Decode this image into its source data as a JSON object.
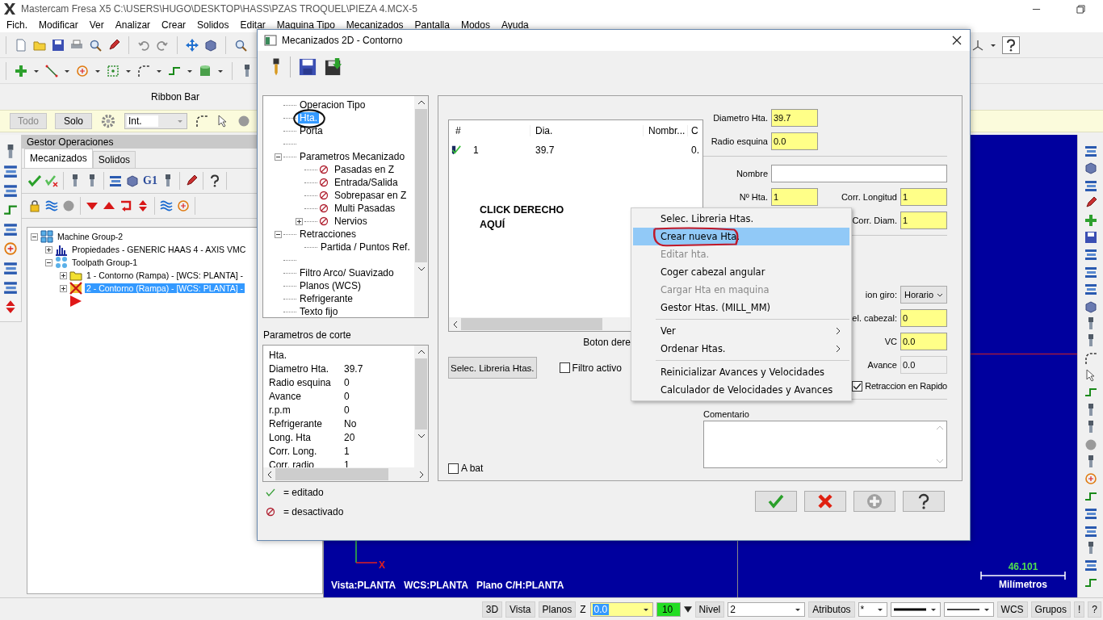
{
  "app": {
    "title": "Mastercam Fresa X5  C:\\USERS\\HUGO\\DESKTOP\\HASS\\PZAS TROQUEL\\PIEZA 4.MCX-5"
  },
  "menu": [
    "Fich.",
    "Modificar",
    "Ver",
    "Analizar",
    "Crear",
    "Solidos",
    "Editar",
    "Maquina Tipo",
    "Mecanizados",
    "Pantalla",
    "Modos",
    "Ayuda"
  ],
  "ribbon_bar": "Ribbon Bar",
  "selection_bar": {
    "buttons": [
      {
        "label": "Todo",
        "disabled": true
      },
      {
        "label": "Solo",
        "disabled": false
      }
    ],
    "mode": "Int."
  },
  "op_manager": {
    "title": "Gestor Operaciones",
    "tabs": [
      {
        "label": "Mecanizados",
        "selected": true
      },
      {
        "label": "Solidos",
        "selected": false
      }
    ],
    "g_code_label": "G1",
    "tree": [
      {
        "kind": "machine",
        "label": "Machine Group-2",
        "selected": false,
        "expanded": true,
        "children": [
          {
            "kind": "properties",
            "label": "Propiedades - GENERIC HAAS 4 - AXIS VMC",
            "selected": false,
            "expanded": false
          },
          {
            "kind": "group",
            "label": "Toolpath Group-1",
            "selected": false,
            "expanded": true,
            "children": [
              {
                "kind": "operation",
                "label": "1 - Contorno  (Rampa) - [WCS: PLANTA] -",
                "selected": false,
                "dirty": false,
                "expanded": false
              },
              {
                "kind": "operation",
                "label": "2 - Contorno  (Rampa) - [WCS: PLANTA] -",
                "selected": true,
                "dirty": true,
                "expanded": false
              },
              {
                "kind": "insert-marker",
                "selected": false
              }
            ]
          }
        ]
      }
    ]
  },
  "viewport": {
    "info": [
      "Vista:PLANTA",
      "WCS:PLANTA",
      "Plano C/H:PLANTA"
    ],
    "x_axis": "X",
    "scale": {
      "value": "46.101",
      "unit": "Milímetros"
    }
  },
  "status_bar": {
    "buttons_left": [
      "3D",
      "Vista",
      "Planos"
    ],
    "z_label": "Z",
    "z_value": "0.0",
    "color_value": "10",
    "level_label": "Nivel",
    "level_value": "2",
    "attributes": "Atributos",
    "point_style": "*",
    "buttons_right": [
      "WCS",
      "Grupos",
      "!",
      "?"
    ]
  },
  "dialog": {
    "title": "Mecanizados 2D - Contorno",
    "tree": [
      {
        "kind": "node",
        "label": "Operacion Tipo",
        "selected": false,
        "circled": false,
        "disabled": false
      },
      {
        "kind": "node",
        "label": "Hta.",
        "selected": true,
        "circled": true,
        "disabled": false
      },
      {
        "kind": "node",
        "label": "Porta",
        "selected": false,
        "circled": false,
        "disabled": false
      },
      {
        "kind": "blank"
      },
      {
        "kind": "node",
        "label": "Parametros Mecanizado",
        "selected": false,
        "circled": false,
        "disabled": false,
        "expanded": true,
        "children": [
          {
            "kind": "node",
            "label": "Pasadas en Z",
            "selected": false,
            "circled": false,
            "disabled": true
          },
          {
            "kind": "node",
            "label": "Entrada/Salida",
            "selected": false,
            "circled": false,
            "disabled": true
          },
          {
            "kind": "node",
            "label": "Sobrepasar en Z",
            "selected": false,
            "circled": false,
            "disabled": true
          },
          {
            "kind": "node",
            "label": "Multi Pasadas",
            "selected": false,
            "circled": false,
            "disabled": true
          },
          {
            "kind": "node",
            "label": "Nervios",
            "selected": false,
            "circled": false,
            "disabled": true,
            "expanded": false
          }
        ]
      },
      {
        "kind": "node",
        "label": "Retracciones",
        "selected": false,
        "circled": false,
        "disabled": false,
        "expanded": true,
        "children": [
          {
            "kind": "node",
            "label": "Partida / Puntos Ref.",
            "selected": false,
            "circled": false,
            "disabled": false
          }
        ]
      },
      {
        "kind": "blank"
      },
      {
        "kind": "node",
        "label": "Filtro Arco/ Suavizado",
        "selected": false,
        "circled": false,
        "disabled": false
      },
      {
        "kind": "node",
        "label": "Planos (WCS)",
        "selected": false,
        "circled": false,
        "disabled": false
      },
      {
        "kind": "node",
        "label": "Refrigerante",
        "selected": false,
        "circled": false,
        "disabled": false
      },
      {
        "kind": "node",
        "label": "Texto fijo",
        "selected": false,
        "circled": false,
        "disabled": false
      }
    ],
    "cut_parameters": {
      "title": "Parametros de corte",
      "rows": [
        {
          "name": "Hta."
        },
        {
          "name": "Diametro Hta.",
          "value": "39.7"
        },
        {
          "name": "Radio esquina",
          "value": "0"
        },
        {
          "name": "Avance",
          "value": "0"
        },
        {
          "name": "r.p.m",
          "value": "0"
        },
        {
          "name": "Refrigerante",
          "value": "No"
        },
        {
          "name": "Long. Hta",
          "value": "20"
        },
        {
          "name": "Corr. Long.",
          "value": "1"
        },
        {
          "name": "Corr. radio",
          "value": "1"
        }
      ]
    },
    "legend": [
      {
        "kind": "edited",
        "label": "= editado"
      },
      {
        "kind": "disabled",
        "label": "= desactivado"
      }
    ],
    "tool_list": {
      "columns": [
        "#",
        "Dia.",
        "Nombr...",
        "C"
      ],
      "rows": [
        {
          "number": "1",
          "diameter": "39.7",
          "column_4": "0."
        }
      ]
    },
    "hint": "CLICK DERECHO\nAQUÍ",
    "right_click_hint": "Boton dere",
    "library_button": "Selec. Libreria Htas.",
    "filter_active": {
      "label": "Filtro activo",
      "checked": false
    },
    "batch": {
      "label": "A bat",
      "checked": false
    },
    "fields": {
      "diameter": {
        "label": "Diametro Hta.",
        "value": "39.7"
      },
      "corner_radius": {
        "label": "Radio esquina",
        "value": "0.0"
      },
      "name": {
        "label": "Nombre"
      },
      "tool_number": {
        "label": "Nº Hta.",
        "value": "1"
      },
      "length_offset": {
        "label": "Corr. Longitud",
        "value": "1"
      },
      "diameter_offset": {
        "label": "Corr. Diam.",
        "value": "1"
      },
      "rotation": {
        "label": "ion giro:",
        "value": "Horario"
      },
      "spindle": {
        "label": "el. cabezal:",
        "value": "0"
      },
      "vc": {
        "label": "VC",
        "value": "0.0"
      },
      "feed": {
        "label": "Avance",
        "value": "0.0",
        "disabled": true
      },
      "rapid_retract": {
        "label": "Retraccion en Rapido",
        "checked": true
      },
      "comment": {
        "label": "Comentario"
      }
    },
    "context_menu": [
      {
        "kind": "item",
        "label": "Selec. Libreria Htas.",
        "selected": false,
        "disabled": false,
        "circled": false,
        "submenu": false
      },
      {
        "kind": "item",
        "label": "Crear nueva Hta.",
        "selected": true,
        "disabled": false,
        "circled": true,
        "submenu": false
      },
      {
        "kind": "item",
        "label": "Editar hta.",
        "selected": false,
        "disabled": true,
        "circled": false,
        "submenu": false
      },
      {
        "kind": "item",
        "label": "Coger cabezal angular",
        "selected": false,
        "disabled": false,
        "circled": false,
        "submenu": false
      },
      {
        "kind": "item",
        "label": "Cargar Hta en maquina",
        "selected": false,
        "disabled": true,
        "circled": false,
        "submenu": false
      },
      {
        "kind": "item",
        "label": "Gestor Htas.  (MILL_MM)",
        "selected": false,
        "disabled": false,
        "circled": false,
        "submenu": false
      },
      {
        "kind": "separator"
      },
      {
        "kind": "item",
        "label": "Ver",
        "selected": false,
        "disabled": false,
        "circled": false,
        "submenu": true
      },
      {
        "kind": "item",
        "label": "Ordenar Htas.",
        "selected": false,
        "disabled": false,
        "circled": false,
        "submenu": true
      },
      {
        "kind": "separator"
      },
      {
        "kind": "item",
        "label": "Reinicializar Avances y Velocidades",
        "selected": false,
        "disabled": false,
        "circled": false,
        "submenu": false
      },
      {
        "kind": "item",
        "label": "Calculador de Velocidades y Avances",
        "selected": false,
        "disabled": false,
        "circled": false,
        "submenu": false
      }
    ],
    "footer_buttons": [
      {
        "kind": "ok",
        "disabled": false
      },
      {
        "kind": "cancel",
        "disabled": false
      },
      {
        "kind": "add",
        "disabled": true
      },
      {
        "kind": "help",
        "disabled": false
      }
    ]
  }
}
